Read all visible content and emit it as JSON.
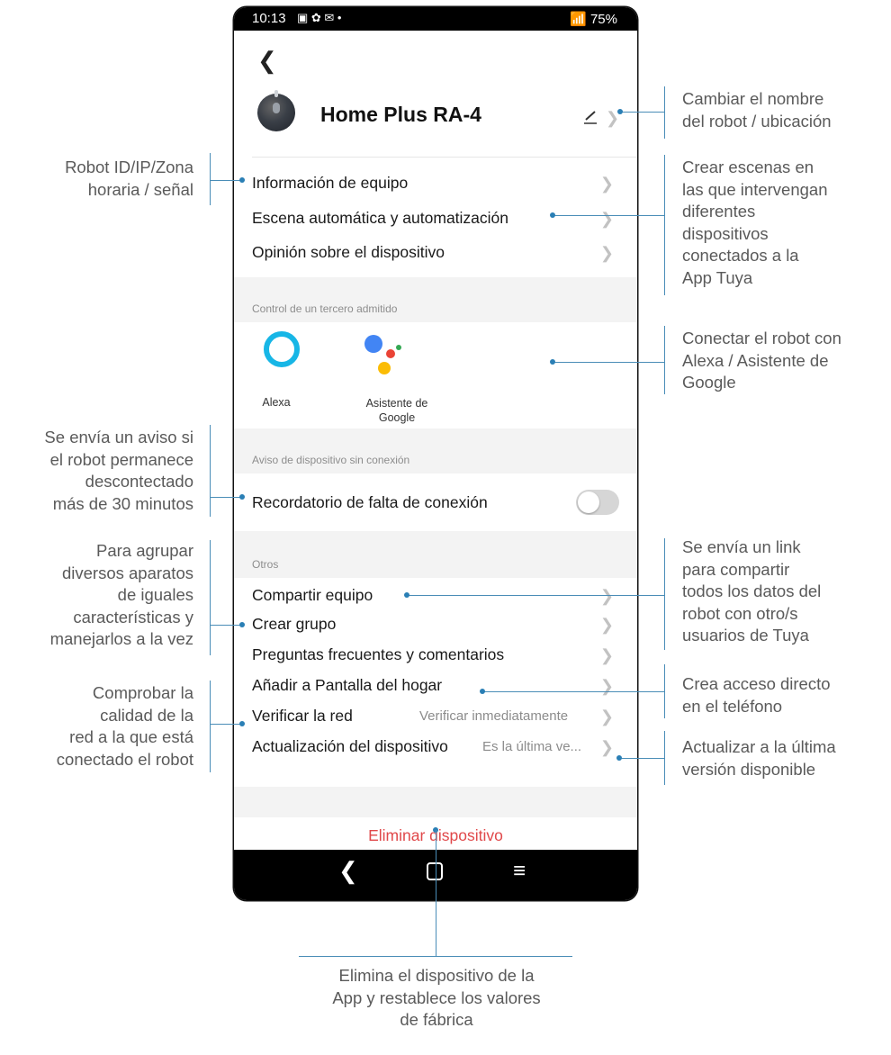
{
  "status_bar": {
    "time": "10:13",
    "notif_icons": "▣ ✿ ✉ •",
    "signal_battery": "📶 75%"
  },
  "header": {
    "back_icon": "chevron-left",
    "device_name": "Home Plus RA-4"
  },
  "device_section": {
    "items": [
      {
        "label": "Información de equipo"
      },
      {
        "label": "Escena automática y automatización"
      },
      {
        "label": "Opinión sobre el dispositivo"
      }
    ]
  },
  "third_party": {
    "caption": "Control de un tercero admitido",
    "alexa_label": "Alexa",
    "google_label": "Asistente de Google"
  },
  "offline_notice": {
    "caption": "Aviso de dispositivo sin conexión",
    "toggle_label": "Recordatorio de falta de conexión",
    "toggle_on": false
  },
  "others": {
    "caption": "Otros",
    "items": [
      {
        "label": "Compartir equipo",
        "value": ""
      },
      {
        "label": "Crear grupo",
        "value": ""
      },
      {
        "label": "Preguntas frecuentes y comentarios",
        "value": ""
      },
      {
        "label": "Añadir a Pantalla del hogar",
        "value": ""
      },
      {
        "label": "Verificar la red",
        "value": "Verificar inmediatamente"
      },
      {
        "label": "Actualización del dispositivo",
        "value": "Es la última ve..."
      }
    ]
  },
  "delete_label": "Eliminar dispositivo",
  "callouts": {
    "rename": [
      "Cambiar el nombre",
      "del robot / ubicación"
    ],
    "device_info": [
      "Robot ID/IP/Zona",
      "horaria / señal"
    ],
    "scenes": [
      "Crear escenas en",
      "las que intervengan",
      "diferentes",
      "dispositivos",
      "conectados a la",
      "App Tuya"
    ],
    "assistants": [
      "Conectar el robot con",
      "Alexa / Asistente de",
      "Google"
    ],
    "offline": [
      "Se envía un aviso si",
      "el robot permanece",
      "descontectado",
      "más de 30 minutos"
    ],
    "share": [
      "Se envía un link",
      "para compartir",
      "todos los datos del",
      "robot con otro/s",
      "usuarios de Tuya"
    ],
    "group": [
      "Para agrupar",
      "diversos aparatos",
      "de iguales",
      "características y",
      "manejarlos a la vez"
    ],
    "shortcut": [
      "Crea acceso directo",
      "en el teléfono"
    ],
    "network": [
      "Comprobar la",
      "calidad de la",
      "red a la que está",
      "conectado el robot"
    ],
    "update": [
      "Actualizar a la última",
      "versión disponible"
    ],
    "delete": [
      "Elimina el dispositivo de la",
      "App y restablece los valores",
      "de fábrica"
    ]
  },
  "colors": {
    "accent_line": "#4a8db7",
    "delete_red": "#e0484a",
    "alexa_blue": "#17b6e6"
  }
}
